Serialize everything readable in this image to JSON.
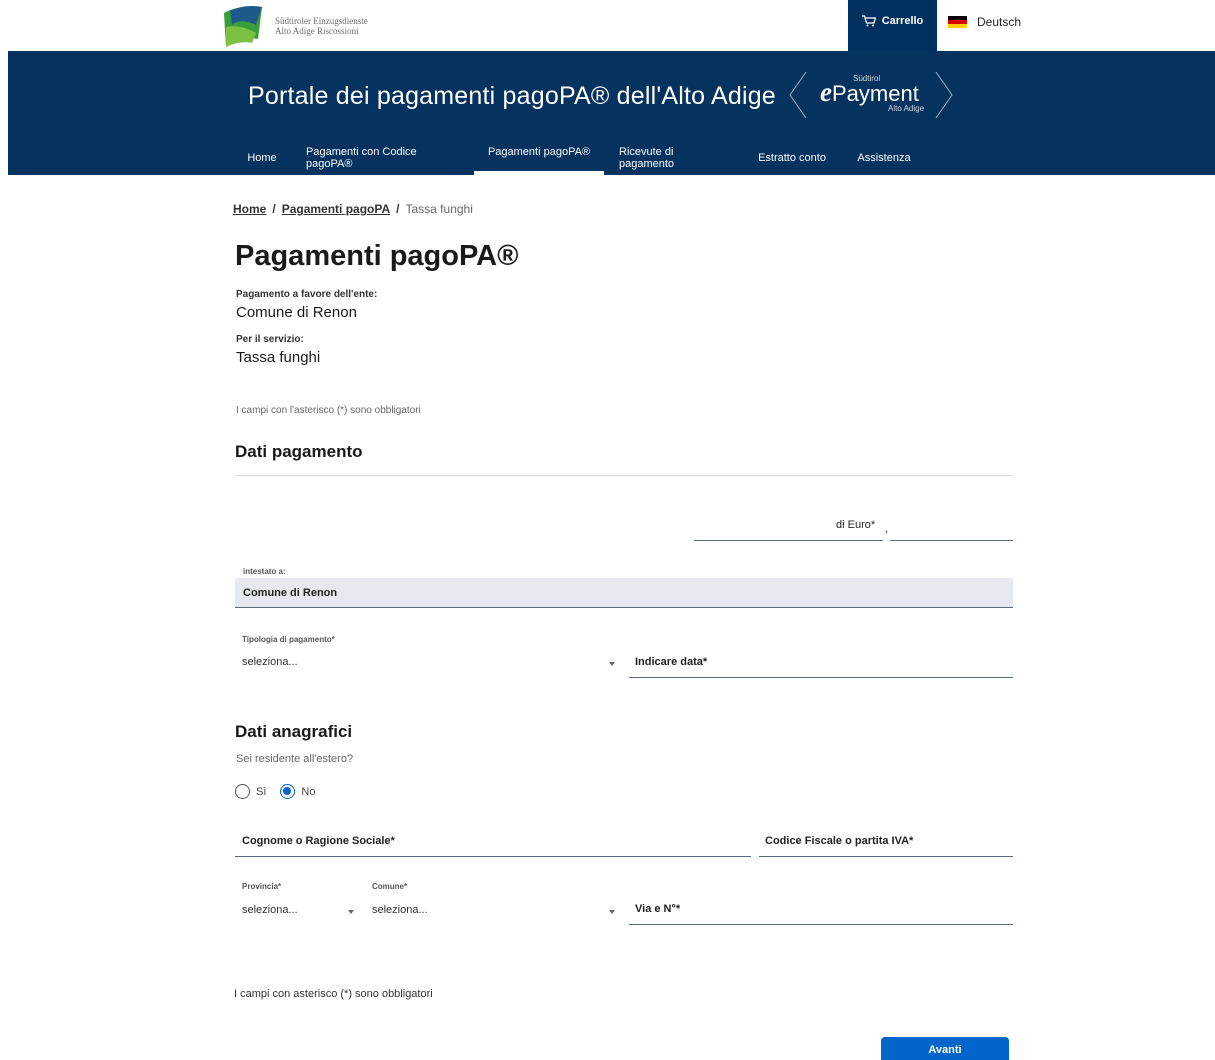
{
  "topbar": {
    "logo_line1": "Südtiroler Einzugsdienste",
    "logo_line2": "Alto Adige Riscossioni",
    "cart_label": "Carrello",
    "language": "Deutsch"
  },
  "header": {
    "title": "Portale dei pagamenti pagoPA® dell'Alto Adige",
    "brand_e": "e",
    "brand_word": "Payment",
    "brand_top": "Südtirol",
    "brand_bottom": "Alto Adige"
  },
  "nav": {
    "items": [
      {
        "label": "Home"
      },
      {
        "label": "Pagamenti con Codice pagoPA®"
      },
      {
        "label": "Pagamenti pagoPA®",
        "active": true
      },
      {
        "label": "Ricevute di pagamento"
      },
      {
        "label": "Estratto conto"
      },
      {
        "label": "Assistenza"
      }
    ]
  },
  "breadcrumb": {
    "home": "Home",
    "section": "Pagamenti pagoPA",
    "current": "Tassa funghi",
    "separator": "/"
  },
  "page": {
    "title": "Pagamenti pagoPA®",
    "ente_label": "Pagamento a favore dell'ente:",
    "ente_value": "Comune di Renon",
    "servizio_label": "Per il servizio:",
    "servizio_value": "Tassa funghi",
    "required_note": "I campi con l'asterisco (*) sono obbligatori",
    "footer_note": "I campi con asterisco (*) sono obbligatori"
  },
  "dati_pagamento": {
    "title": "Dati pagamento",
    "euro_label": "di Euro*",
    "cents_separator": ",",
    "intestato_label": "intestato a:",
    "intestato_value": "Comune di Renon",
    "tipologia_label": "Tipologia di pagamento*",
    "tipologia_value": "seleziona...",
    "data_label": "Indicare data*"
  },
  "dati_anagrafici": {
    "title": "Dati anagrafici",
    "residente_question": "Sei residente all'estero?",
    "radio_si": "Sì",
    "radio_no": "No",
    "selected": "No",
    "cognome_label": "Cognome o Ragione Sociale*",
    "cf_label": "Codice Fiscale o partita IVA*",
    "provincia_label": "Provincia*",
    "provincia_value": "seleziona...",
    "comune_label": "Comune*",
    "comune_value": "seleziona...",
    "via_label": "Via e N°*"
  },
  "actions": {
    "next_label": "Avanti"
  },
  "colors": {
    "header_bg": "#05325f",
    "primary_button": "#0066cc",
    "readonly_bg": "#e6e9f0"
  }
}
